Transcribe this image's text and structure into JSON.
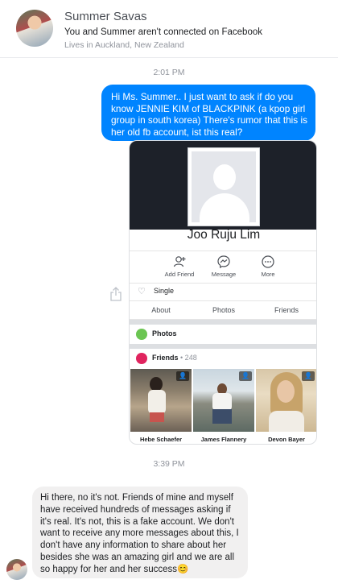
{
  "header": {
    "name": "Summer Savas",
    "connection": "You and Summer aren't connected on Facebook",
    "location": "Lives in Auckland, New Zealand"
  },
  "timestamps": [
    "2:01 PM",
    "3:39 PM"
  ],
  "messages": {
    "outgoing": "Hi Ms. Summer.. I just want to ask if do you know JENNIE KIM of BLACKPINK (a kpop girl group in south korea) There's rumor that this is her old fb account, ist this real?",
    "incoming": "Hi there, no it's not. Friends of mine and myself have received hundreds of messages asking if it's real. It's not, this is a fake account. We don't want to receive any more messages about this, I don't have any information to share about her besides she was an amazing girl and we are all so happy for her and her success😊"
  },
  "profile": {
    "name": "Joo Ruju Lim",
    "actions": [
      "Add Friend",
      "Message",
      "More"
    ],
    "relationship": "Single",
    "tabs": [
      "About",
      "Photos",
      "Friends"
    ],
    "photos_label": "Photos",
    "friends_label": "Friends",
    "friends_count": "• 248",
    "friends": [
      "Hebe Schaefer",
      "James Flannery",
      "Devon Bayer"
    ]
  },
  "colors": {
    "outgoing_bubble": "#0084ff",
    "incoming_bubble": "#f1f0f0",
    "photos_icon": "#6bc552",
    "friends_icon": "#e0245e"
  }
}
